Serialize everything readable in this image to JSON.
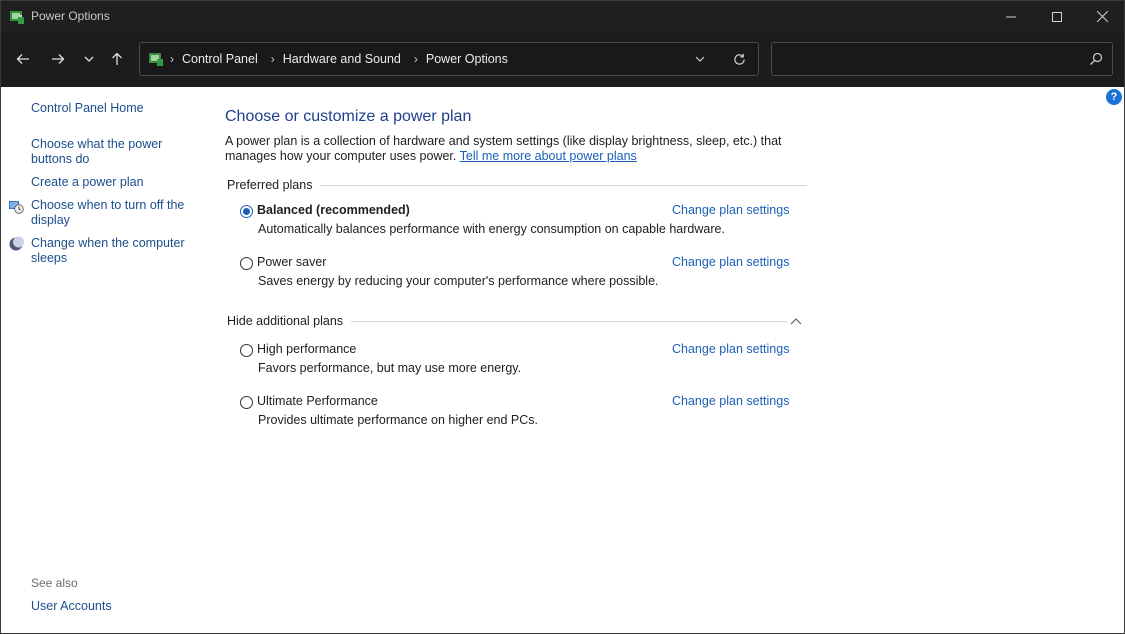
{
  "window": {
    "title": "Power Options"
  },
  "nav": {
    "breadcrumbs": [
      "Control Panel",
      "Hardware and Sound",
      "Power Options"
    ],
    "search_placeholder": ""
  },
  "sidebar": {
    "home": "Control Panel Home",
    "items": [
      {
        "label": "Choose what the power buttons do",
        "icon": ""
      },
      {
        "label": "Create a power plan",
        "icon": ""
      },
      {
        "label": "Choose when to turn off the display",
        "icon": "display-power-icon"
      },
      {
        "label": "Change when the computer sleeps",
        "icon": "moon-sleep-icon"
      }
    ],
    "see_also_label": "See also",
    "see_also_items": [
      "User Accounts"
    ]
  },
  "main": {
    "title": "Choose or customize a power plan",
    "intro_text": "A power plan is a collection of hardware and system settings (like display brightness, sleep, etc.) that manages how your computer uses power.",
    "intro_link": "Tell me more about power plans",
    "preferred_header": "Preferred plans",
    "additional_header": "Hide additional plans",
    "change_label": "Change plan settings",
    "plans": [
      {
        "name": "Balanced (recommended)",
        "desc": "Automatically balances performance with energy consumption on capable hardware.",
        "selected": true
      },
      {
        "name": "Power saver",
        "desc": "Saves energy by reducing your computer's performance where possible.",
        "selected": false
      },
      {
        "name": "High performance",
        "desc": "Favors performance, but may use more energy.",
        "selected": false
      },
      {
        "name": "Ultimate Performance",
        "desc": "Provides ultimate performance on higher end PCs.",
        "selected": false
      }
    ]
  },
  "colors": {
    "titlebar_bg": "#1f1f1f",
    "link": "#1c5fb8",
    "heading": "#1e3e8e",
    "accent": "#1a5fb4"
  }
}
